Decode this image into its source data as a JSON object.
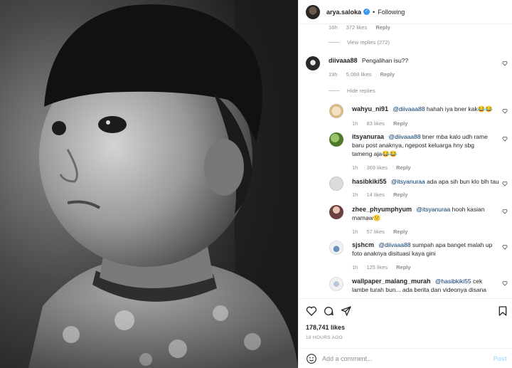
{
  "header": {
    "username": "arya.saloka",
    "separator": "•",
    "follow_status": "Following"
  },
  "prev_comment_meta": {
    "time": "16h",
    "likes": "372 likes",
    "reply": "Reply"
  },
  "prev_view_replies": "View replies (272)",
  "main_comment": {
    "username": "diivaaa88",
    "text": "Pengalihan isu??",
    "time": "19h",
    "likes": "5,088 likes",
    "reply": "Reply",
    "hide_replies": "Hide replies"
  },
  "replies": [
    {
      "username": "wahyu_ni91",
      "mention": "@diivaaa88",
      "text": "hahah iya bner kak😂😂",
      "time": "1h",
      "likes": "83 likes",
      "reply": "Reply"
    },
    {
      "username": "itsyanuraa",
      "mention": "@diivaaa88",
      "text": "bner mba kalo udh rame baru post anaknya, ngepost keluarga hny sbg tameng aja😂😂",
      "time": "1h",
      "likes": "369 likes",
      "reply": "Reply"
    },
    {
      "username": "hasibkiki55",
      "mention": "@itsyanuraa",
      "text": "ada apa sih bun klo blh tau",
      "time": "1h",
      "likes": "14 likes",
      "reply": "Reply"
    },
    {
      "username": "zhee_phyumphyum",
      "mention": "@itsyanuraa",
      "text": "hooh kasian mamaw😕",
      "time": "1h",
      "likes": "57 likes",
      "reply": "Reply"
    },
    {
      "username": "sjshcm",
      "mention": "@diivaaa88",
      "text": "sumpah apa banget malah up foto anaknya disituasi kaya gini",
      "time": "1h",
      "likes": "125 likes",
      "reply": "Reply"
    },
    {
      "username": "wallpaper_malang_murah",
      "mention": "@hasibkiki55",
      "text": "cek lambe turah bun... ada berita dan videonya disana",
      "time": "",
      "likes": "",
      "reply": ""
    }
  ],
  "actions": {
    "likes": "178,741 likes",
    "timestamp": "19 HOURS AGO"
  },
  "add_comment": {
    "placeholder": "Add a comment...",
    "post_label": "Post"
  },
  "icons": {
    "like": "heart-icon",
    "comment": "comment-icon",
    "share": "share-icon",
    "save": "bookmark-icon",
    "verified": "verified-badge-icon",
    "emoji": "emoji-icon"
  },
  "colors": {
    "verified": "#3897f0",
    "mention": "#00376b",
    "muted": "#8e8e8e",
    "post_disabled": "#b2dffc"
  }
}
